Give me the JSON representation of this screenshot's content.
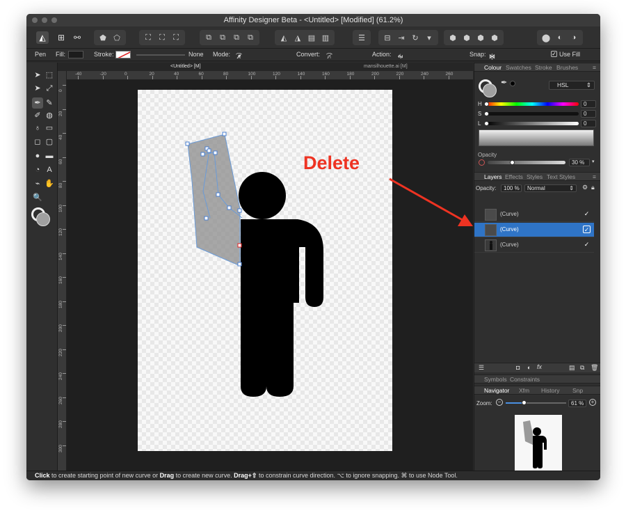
{
  "window": {
    "title": "Affinity Designer Beta - <Untitled> [Modified] (61.2%)"
  },
  "toolbar": {
    "persona_icons": [
      "affinity-logo-icon",
      "pixel-grid-icon",
      "export-nodes-icon"
    ],
    "groups": [
      [
        "⬟",
        "⬠"
      ],
      [
        "⛶",
        "⛶",
        "⛶"
      ],
      [
        "⧉",
        "⧉",
        "⧉",
        "⧉"
      ],
      [
        "◭",
        "◮",
        "▤",
        "▥"
      ],
      [
        "☰"
      ],
      [
        "⊟",
        "⇥",
        "↻",
        "▾"
      ],
      [
        "⬢",
        "⬢",
        "⬢",
        "⬢"
      ],
      [
        "⬤",
        "◐",
        "◑"
      ]
    ]
  },
  "context": {
    "tool": "Pen",
    "fill_label": "Fill:",
    "stroke_label": "Stroke:",
    "stroke_value": "None",
    "mode_label": "Mode:",
    "mode_icons": [
      "⌒",
      "∧",
      "⟋",
      "↗"
    ],
    "convert_label": "Convert:",
    "convert_icons": [
      "⟋",
      "⌒",
      "∩"
    ],
    "action_label": "Action:",
    "action_icons": [
      "⫶",
      "⫶",
      "∿",
      "↤"
    ],
    "snap_label": "Snap:",
    "snap_icons": [
      "⋈",
      "⟠",
      "⋊",
      "⋉"
    ],
    "use_fill_label": "Use Fill"
  },
  "tools": [
    "➤",
    "⬚",
    "➤",
    "⤢",
    "✒",
    "✎",
    "✐",
    "◍",
    "♁",
    "▭",
    "◻",
    "▢",
    "●",
    "▬",
    "◔",
    "A",
    "⌁",
    "✋",
    "🔍"
  ],
  "tabs": {
    "doc": "<Untitled> [M]",
    "other": "mansilhouette.ai [M]"
  },
  "ruler": {
    "h": [
      "-40",
      "-20",
      "0",
      "20",
      "40",
      "60",
      "80",
      "100",
      "120",
      "140",
      "160",
      "180",
      "200",
      "220",
      "240",
      "260"
    ],
    "v": [
      "0",
      "20",
      "40",
      "60",
      "80",
      "100",
      "120",
      "140",
      "160",
      "180",
      "200",
      "220",
      "240",
      "260",
      "280",
      "300"
    ],
    "unit": "mm"
  },
  "annotation": {
    "text": "Delete",
    "color": "#ee3322"
  },
  "colour_panel": {
    "tabs": [
      "Colour",
      "Swatches",
      "Stroke",
      "Brushes"
    ],
    "model": "HSL",
    "h_label": "H",
    "h_value": "0",
    "s_label": "S",
    "s_value": "0",
    "l_label": "L",
    "l_value": "0",
    "opacity_label": "Opacity",
    "opacity_value": "30 %"
  },
  "layers_panel": {
    "tabs": [
      "Layers",
      "Effects",
      "Styles",
      "Text Styles"
    ],
    "opacity_label": "Opacity:",
    "opacity_value": "100 %",
    "blend_mode": "Normal",
    "items": [
      {
        "name": "(Curve)",
        "check": "✓"
      },
      {
        "name": "(Curve)",
        "check": "✓"
      },
      {
        "name": "(Curve)",
        "check": "✓"
      }
    ],
    "footer_icons": [
      "layers-icon",
      "mask-icon",
      "adjustment-icon",
      "fx-icon",
      "add-layer-icon",
      "duplicate-icon",
      "trash-icon"
    ]
  },
  "symbols_tabs": [
    "Symbols",
    "Constraints"
  ],
  "navigator": {
    "tabs": [
      "Navigator",
      "Xfm",
      "History",
      "Snp"
    ],
    "zoom_label": "Zoom:",
    "zoom_value": "61 %",
    "zoom_level": 0.3
  },
  "status": {
    "click": "Click",
    "t1": " to create starting point of new curve or ",
    "drag": "Drag",
    "t2": " to create new curve. ",
    "drag_shift": "Drag+⇧",
    "t3": " to constrain curve direction. ⌥ to ignore snapping. ⌘ to use Node Tool."
  }
}
